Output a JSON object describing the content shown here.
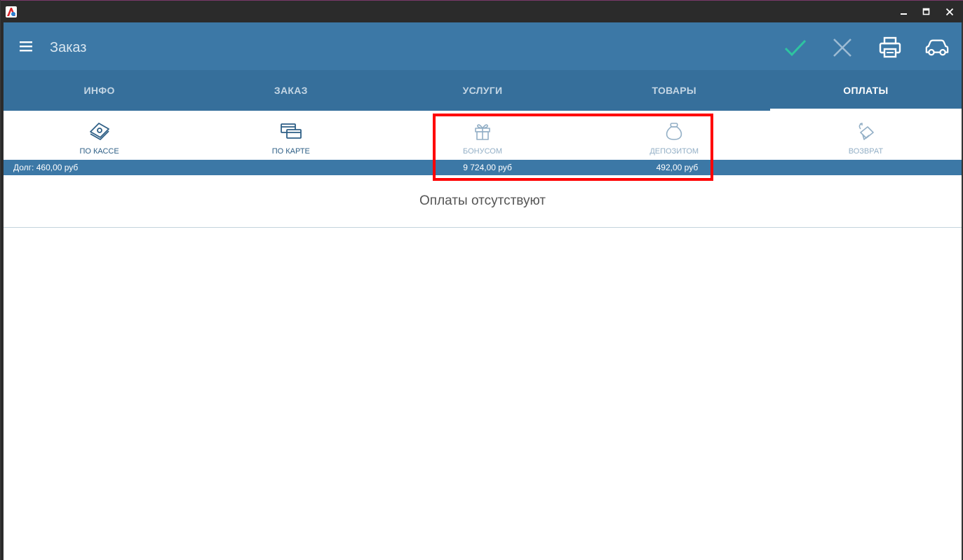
{
  "header": {
    "title": "Заказ"
  },
  "tabs": [
    {
      "label": "ИНФО",
      "active": false
    },
    {
      "label": "ЗАКАЗ",
      "active": false
    },
    {
      "label": "УСЛУГИ",
      "active": false
    },
    {
      "label": "ТОВАРЫ",
      "active": false
    },
    {
      "label": "ОПЛАТЫ",
      "active": true
    }
  ],
  "payment_methods": [
    {
      "label": "ПО КАССЕ",
      "icon": "cash-icon",
      "enabled": true
    },
    {
      "label": "ПО КАРТЕ",
      "icon": "cards-icon",
      "enabled": true
    },
    {
      "label": "БОНУСОМ",
      "icon": "gift-icon",
      "enabled": false
    },
    {
      "label": "ДЕПОЗИТОМ",
      "icon": "money-bag-icon",
      "enabled": false
    },
    {
      "label": "ВОЗВРАТ",
      "icon": "refund-icon",
      "enabled": false
    }
  ],
  "balances": {
    "debt": "Долг: 460,00 руб",
    "bonus": "9 724,00 руб",
    "deposit": "492,00 руб"
  },
  "empty_state": "Оплаты отсутствуют",
  "colors": {
    "header": "#3c78a6",
    "tabs": "#366f9b",
    "confirm": "#2ec4a0",
    "highlight": "#ff0000"
  }
}
